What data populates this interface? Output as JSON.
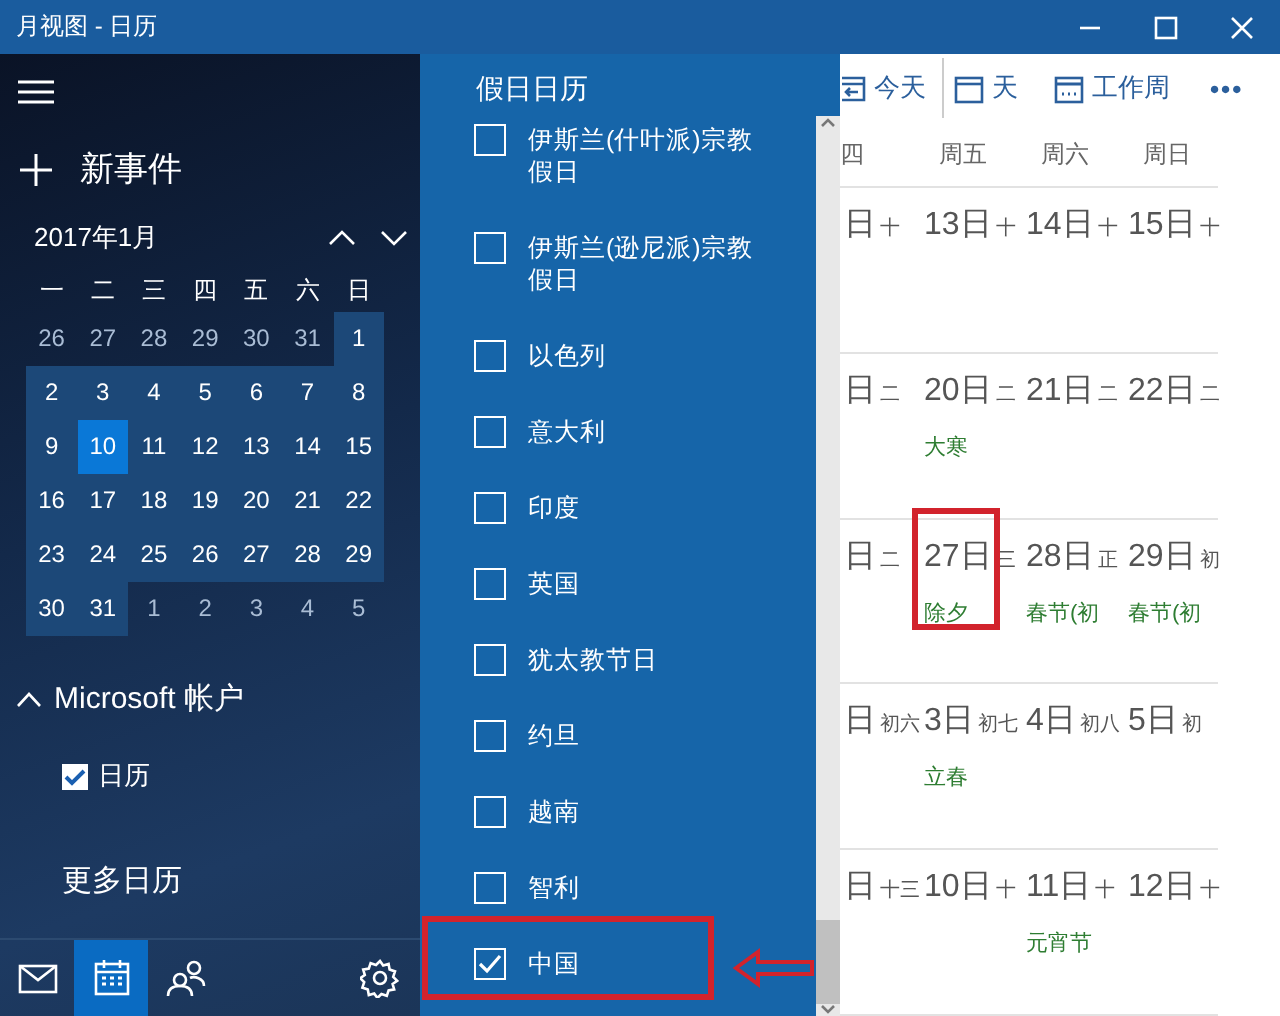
{
  "window": {
    "title": "月视图 - 日历"
  },
  "sidebar": {
    "new_event": "新事件",
    "month": "2017年1月",
    "weekdays": [
      "一",
      "二",
      "三",
      "四",
      "五",
      "六",
      "日"
    ],
    "days": [
      {
        "label": "26",
        "in_month": false,
        "selected": false
      },
      {
        "label": "27",
        "in_month": false,
        "selected": false
      },
      {
        "label": "28",
        "in_month": false,
        "selected": false
      },
      {
        "label": "29",
        "in_month": false,
        "selected": false
      },
      {
        "label": "30",
        "in_month": false,
        "selected": false
      },
      {
        "label": "31",
        "in_month": false,
        "selected": false
      },
      {
        "label": "1",
        "in_month": true,
        "selected": false
      },
      {
        "label": "2",
        "in_month": true,
        "selected": false
      },
      {
        "label": "3",
        "in_month": true,
        "selected": false
      },
      {
        "label": "4",
        "in_month": true,
        "selected": false
      },
      {
        "label": "5",
        "in_month": true,
        "selected": false
      },
      {
        "label": "6",
        "in_month": true,
        "selected": false
      },
      {
        "label": "7",
        "in_month": true,
        "selected": false
      },
      {
        "label": "8",
        "in_month": true,
        "selected": false
      },
      {
        "label": "9",
        "in_month": true,
        "selected": false
      },
      {
        "label": "10",
        "in_month": true,
        "selected": true
      },
      {
        "label": "11",
        "in_month": true,
        "selected": false
      },
      {
        "label": "12",
        "in_month": true,
        "selected": false
      },
      {
        "label": "13",
        "in_month": true,
        "selected": false
      },
      {
        "label": "14",
        "in_month": true,
        "selected": false
      },
      {
        "label": "15",
        "in_month": true,
        "selected": false
      },
      {
        "label": "16",
        "in_month": true,
        "selected": false
      },
      {
        "label": "17",
        "in_month": true,
        "selected": false
      },
      {
        "label": "18",
        "in_month": true,
        "selected": false
      },
      {
        "label": "19",
        "in_month": true,
        "selected": false
      },
      {
        "label": "20",
        "in_month": true,
        "selected": false
      },
      {
        "label": "21",
        "in_month": true,
        "selected": false
      },
      {
        "label": "22",
        "in_month": true,
        "selected": false
      },
      {
        "label": "23",
        "in_month": true,
        "selected": false
      },
      {
        "label": "24",
        "in_month": true,
        "selected": false
      },
      {
        "label": "25",
        "in_month": true,
        "selected": false
      },
      {
        "label": "26",
        "in_month": true,
        "selected": false
      },
      {
        "label": "27",
        "in_month": true,
        "selected": false
      },
      {
        "label": "28",
        "in_month": true,
        "selected": false
      },
      {
        "label": "29",
        "in_month": true,
        "selected": false
      },
      {
        "label": "30",
        "in_month": true,
        "selected": false
      },
      {
        "label": "31",
        "in_month": true,
        "selected": false
      },
      {
        "label": "1",
        "in_month": false,
        "selected": false
      },
      {
        "label": "2",
        "in_month": false,
        "selected": false
      },
      {
        "label": "3",
        "in_month": false,
        "selected": false
      },
      {
        "label": "4",
        "in_month": false,
        "selected": false
      },
      {
        "label": "5",
        "in_month": false,
        "selected": false
      }
    ],
    "account": {
      "label": "Microsoft 帐户",
      "expanded": true
    },
    "calendars": [
      {
        "label": "日历",
        "checked": true
      }
    ],
    "more": "更多日历",
    "nav": [
      {
        "kind": "mail",
        "selected": false
      },
      {
        "kind": "calendar",
        "selected": true
      },
      {
        "kind": "people",
        "selected": false
      },
      {
        "kind": "settings",
        "selected": false
      }
    ]
  },
  "holiday_panel": {
    "title": "假日日历",
    "items": [
      {
        "label": "伊斯兰(什叶派)宗教假日",
        "checked": false
      },
      {
        "label": "伊斯兰(逊尼派)宗教假日",
        "checked": false
      },
      {
        "label": "以色列",
        "checked": false
      },
      {
        "label": "意大利",
        "checked": false
      },
      {
        "label": "印度",
        "checked": false
      },
      {
        "label": "英国",
        "checked": false
      },
      {
        "label": "犹太教节日",
        "checked": false
      },
      {
        "label": "约旦",
        "checked": false
      },
      {
        "label": "越南",
        "checked": false
      },
      {
        "label": "智利",
        "checked": false
      },
      {
        "label": "中国",
        "checked": true,
        "highlighted": true
      }
    ]
  },
  "toolbar": [
    {
      "kind": "today",
      "label": "今天"
    },
    {
      "kind": "day",
      "label": "天"
    },
    {
      "kind": "workweek",
      "label": "工作周"
    },
    {
      "kind": "more",
      "label": "•••"
    }
  ],
  "month_view": {
    "weekdays": [
      "四",
      "周五",
      "周六",
      "周日"
    ],
    "weeks": [
      {
        "cells": [
          {
            "day": "日",
            "lunar": "十"
          },
          {
            "day": "13日",
            "lunar": "十"
          },
          {
            "day": "14日",
            "lunar": "十"
          },
          {
            "day": "15日",
            "lunar": "十"
          }
        ]
      },
      {
        "cells": [
          {
            "day": "日",
            "lunar": "二"
          },
          {
            "day": "20日",
            "lunar": "二",
            "events": [
              "大寒"
            ]
          },
          {
            "day": "21日",
            "lunar": "二"
          },
          {
            "day": "22日",
            "lunar": "二"
          }
        ]
      },
      {
        "cells": [
          {
            "day": "日",
            "lunar": "二"
          },
          {
            "day": "27日",
            "lunar": "三",
            "events": [
              "除夕"
            ],
            "highlighted": true
          },
          {
            "day": "28日",
            "lunar": "正",
            "events": [
              "春节(初"
            ]
          },
          {
            "day": "29日",
            "lunar": "初",
            "events": [
              "春节(初"
            ]
          }
        ]
      },
      {
        "cells": [
          {
            "day": "日",
            "lunar": "初六"
          },
          {
            "day": "3日",
            "lunar": "初七",
            "events": [
              "立春"
            ]
          },
          {
            "day": "4日",
            "lunar": "初八"
          },
          {
            "day": "5日",
            "lunar": "初"
          }
        ]
      },
      {
        "cells": [
          {
            "day": "日",
            "lunar": "十三"
          },
          {
            "day": "10日",
            "lunar": "十"
          },
          {
            "day": "11日",
            "lunar": "十",
            "events": [
              "元宵节"
            ]
          },
          {
            "day": "12日",
            "lunar": "十"
          }
        ]
      }
    ]
  }
}
